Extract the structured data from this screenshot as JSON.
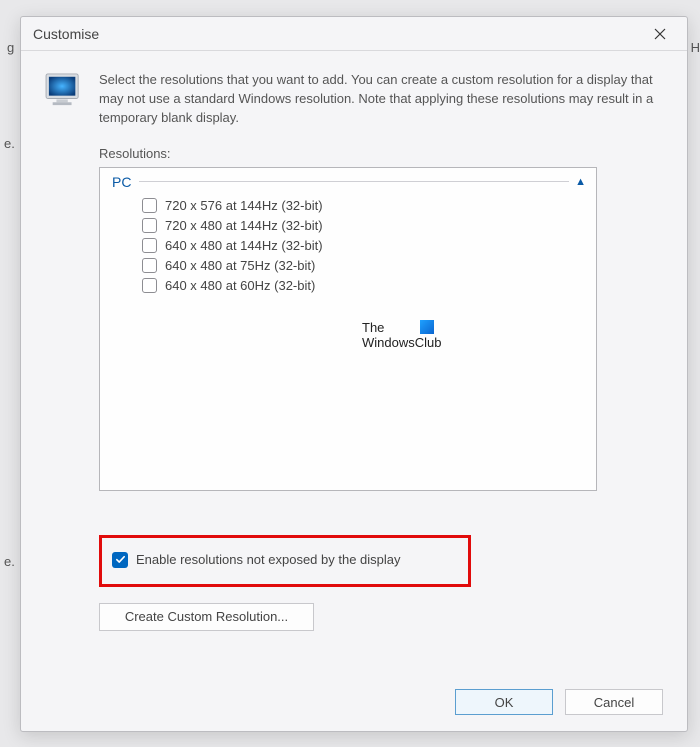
{
  "backdrop": {
    "t1": "g",
    "t2": "n H",
    "t3": "e.",
    "t4": "e."
  },
  "dialog": {
    "title": "Customise",
    "intro": "Select the resolutions that you want to add. You can create a custom resolution for a display that may not use a standard Windows resolution. Note that applying these resolutions may result in a temporary blank display.",
    "resolutions_label": "Resolutions:",
    "group": "PC",
    "items": [
      "720 x 576 at 144Hz (32-bit)",
      "720 x 480 at 144Hz (32-bit)",
      "640 x 480 at 144Hz (32-bit)",
      "640 x 480 at 75Hz (32-bit)",
      "640 x 480 at 60Hz (32-bit)"
    ],
    "enable_label": "Enable resolutions not exposed by the display",
    "create_label": "Create Custom Resolution...",
    "ok": "OK",
    "cancel": "Cancel"
  },
  "watermark": {
    "line1": "The",
    "line2": "WindowsClub"
  }
}
